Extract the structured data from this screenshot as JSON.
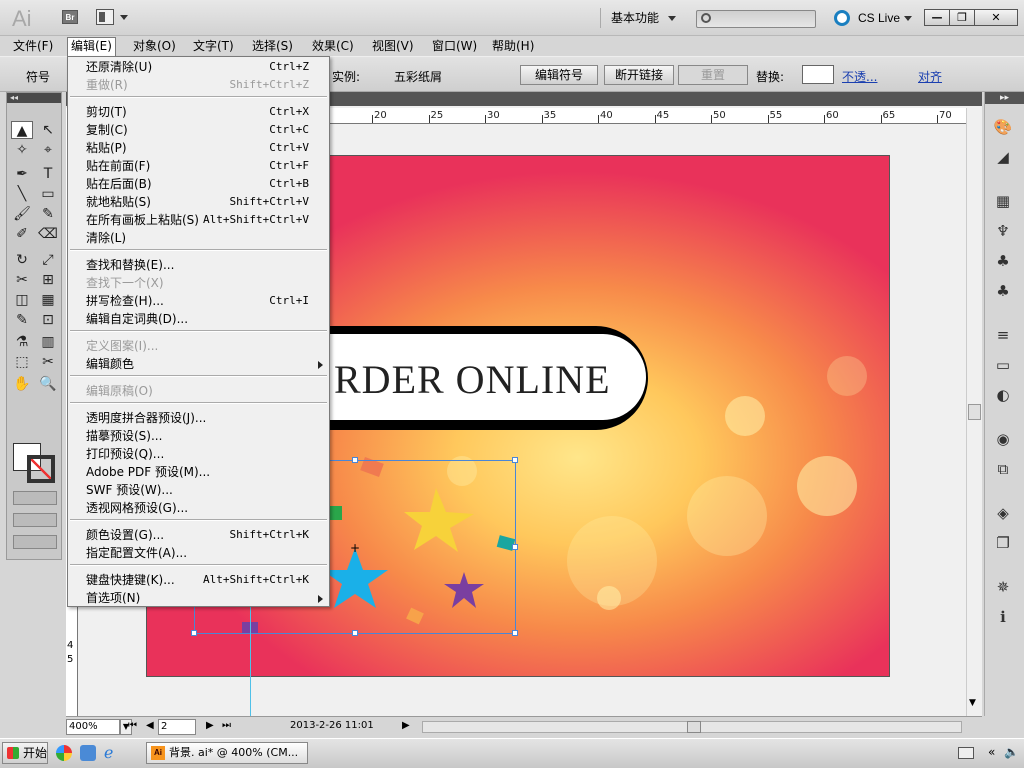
{
  "titlebar": {
    "app_logo": "Ai",
    "bridge": "Br",
    "workspace": "基本功能",
    "cslive": "CS Live",
    "min": "—",
    "restore": "❐",
    "close": "✕"
  },
  "menubar": [
    "文件(F)",
    "编辑(E)",
    "对象(O)",
    "文字(T)",
    "选择(S)",
    "效果(C)",
    "视图(V)",
    "窗口(W)",
    "帮助(H)"
  ],
  "controlbar": {
    "symbol_label": "符号",
    "instance_label": "实例:",
    "instance_value": "五彩纸屑",
    "edit_symbol": "编辑符号",
    "break_link": "断开链接",
    "reset": "重置",
    "replace_label": "替换:",
    "opacity_link": "不透...",
    "align_link": "对齐"
  },
  "doc_tab": "«",
  "ruler_top": [
    "20",
    "25",
    "30",
    "35",
    "40",
    "45",
    "50",
    "55",
    "60",
    "65",
    "70"
  ],
  "ruler_left": [
    "4",
    "5"
  ],
  "artwork": {
    "banner_text": "RDER ONLINE"
  },
  "statusbar": {
    "zoom": "400%",
    "page": "2",
    "date": "2013-2-26  11:01"
  },
  "taskbar": {
    "start": "开始",
    "task": "背景. ai* @ 400% (CM..."
  },
  "edit_menu": [
    {
      "label": "还原清除(U)",
      "shortcut": "Ctrl+Z",
      "disabled": false
    },
    {
      "label": "重做(R)",
      "shortcut": "Shift+Ctrl+Z",
      "disabled": true
    },
    {
      "sep": true
    },
    {
      "label": "剪切(T)",
      "shortcut": "Ctrl+X",
      "disabled": false
    },
    {
      "label": "复制(C)",
      "shortcut": "Ctrl+C",
      "disabled": false
    },
    {
      "label": "粘贴(P)",
      "shortcut": "Ctrl+V",
      "disabled": false
    },
    {
      "label": "贴在前面(F)",
      "shortcut": "Ctrl+F",
      "disabled": false
    },
    {
      "label": "贴在后面(B)",
      "shortcut": "Ctrl+B",
      "disabled": false
    },
    {
      "label": "就地粘贴(S)",
      "shortcut": "Shift+Ctrl+V",
      "disabled": false
    },
    {
      "label": "在所有画板上粘贴(S)",
      "shortcut": "Alt+Shift+Ctrl+V",
      "disabled": false
    },
    {
      "label": "清除(L)",
      "shortcut": "",
      "disabled": false
    },
    {
      "sep": true
    },
    {
      "label": "查找和替换(E)...",
      "shortcut": "",
      "disabled": false
    },
    {
      "label": "查找下一个(X)",
      "shortcut": "",
      "disabled": true
    },
    {
      "label": "拼写检查(H)...",
      "shortcut": "Ctrl+I",
      "disabled": false
    },
    {
      "label": "编辑自定词典(D)...",
      "shortcut": "",
      "disabled": false
    },
    {
      "sep": true
    },
    {
      "label": "定义图案(I)...",
      "shortcut": "",
      "disabled": true
    },
    {
      "label": "编辑颜色",
      "shortcut": "",
      "disabled": false,
      "submenu": true
    },
    {
      "sep": true
    },
    {
      "label": "编辑原稿(O)",
      "shortcut": "",
      "disabled": true
    },
    {
      "sep": true
    },
    {
      "label": "透明度拼合器预设(J)...",
      "shortcut": "",
      "disabled": false
    },
    {
      "label": "描摹预设(S)...",
      "shortcut": "",
      "disabled": false
    },
    {
      "label": "打印预设(Q)...",
      "shortcut": "",
      "disabled": false
    },
    {
      "label": "Adobe PDF 预设(M)...",
      "shortcut": "",
      "disabled": false
    },
    {
      "label": "SWF 预设(W)...",
      "shortcut": "",
      "disabled": false
    },
    {
      "label": "透视网格预设(G)...",
      "shortcut": "",
      "disabled": false
    },
    {
      "sep": true
    },
    {
      "label": "颜色设置(G)...",
      "shortcut": "Shift+Ctrl+K",
      "disabled": false
    },
    {
      "label": "指定配置文件(A)...",
      "shortcut": "",
      "disabled": false
    },
    {
      "sep": true
    },
    {
      "label": "键盘快捷键(K)...",
      "shortcut": "Alt+Shift+Ctrl+K",
      "disabled": false
    },
    {
      "label": "首选项(N)",
      "shortcut": "",
      "disabled": false,
      "submenu": true
    }
  ],
  "tools": [
    "▲",
    "↖",
    "✧",
    "⌖",
    "✒",
    "T",
    "╲",
    "▭",
    "🖌",
    "✎",
    "✐",
    "⌫",
    "↻",
    "⤢",
    "✂",
    "⊞",
    "◫",
    "▦",
    "✎",
    "⊡",
    "⚗",
    "▥",
    "⬚",
    "✂",
    "✋",
    "🔍"
  ],
  "right_icons": [
    "palette-icon",
    "brush-icon",
    "grid-icon",
    "swatch-icon",
    "club-icon",
    "symbol-icon",
    "stroke-icon",
    "gradient-icon",
    "transparency-icon",
    "appearance-icon",
    "graphic-style-icon",
    "layers-icon",
    "artboard-icon",
    "navigator-icon",
    "info-icon"
  ]
}
